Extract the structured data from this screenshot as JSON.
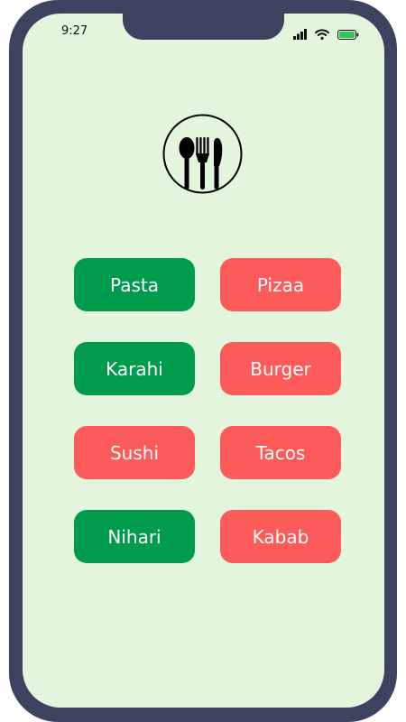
{
  "status_bar": {
    "time": "9:27",
    "signal_icon": "cellular-signal-icon",
    "wifi_icon": "wifi-icon",
    "battery_icon": "battery-icon"
  },
  "logo": {
    "icon": "cutlery-icon"
  },
  "colors": {
    "green": "#009b4c",
    "red": "#fd5a5a",
    "screen_bg": "#e4f5de",
    "frame": "#3d4260"
  },
  "foods": [
    {
      "label": "Pasta",
      "color": "green"
    },
    {
      "label": "Pizaa",
      "color": "red"
    },
    {
      "label": "Karahi",
      "color": "green"
    },
    {
      "label": "Burger",
      "color": "red"
    },
    {
      "label": "Sushi",
      "color": "red"
    },
    {
      "label": "Tacos",
      "color": "red"
    },
    {
      "label": "Nihari",
      "color": "green"
    },
    {
      "label": "Kabab",
      "color": "red"
    }
  ]
}
